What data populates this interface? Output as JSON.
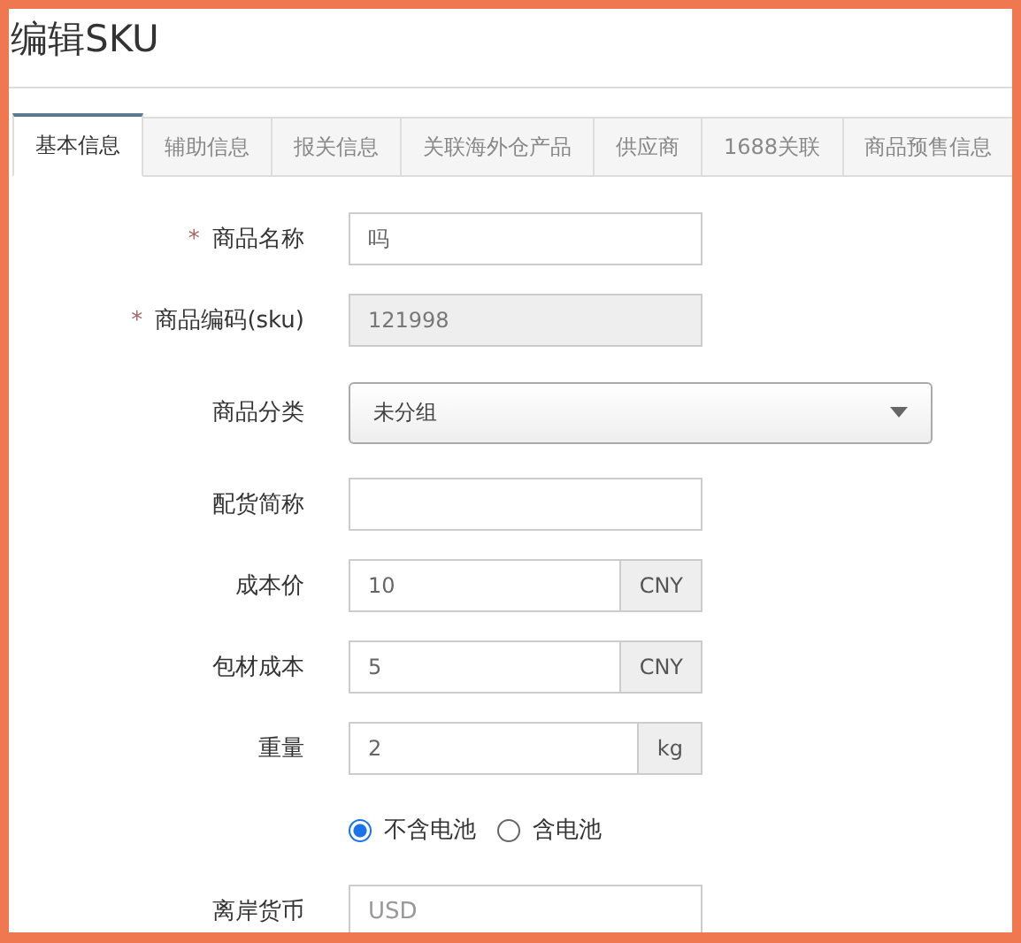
{
  "title": "编辑SKU",
  "tabs": [
    {
      "label": "基本信息",
      "selected": true
    },
    {
      "label": "辅助信息",
      "selected": false
    },
    {
      "label": "报关信息",
      "selected": false
    },
    {
      "label": "关联海外仓产品",
      "selected": false
    },
    {
      "label": "供应商",
      "selected": false
    },
    {
      "label": "1688关联",
      "selected": false
    },
    {
      "label": "商品预售信息",
      "selected": false
    }
  ],
  "fields": [
    {
      "kind": "text",
      "required_mark": "*",
      "label": "商品名称",
      "value": "吗"
    },
    {
      "kind": "text",
      "required_mark": "*",
      "label": "商品编码(sku)",
      "value": "121998",
      "disabled": true
    },
    {
      "kind": "select",
      "label": "商品分类",
      "value": "未分组"
    },
    {
      "kind": "text",
      "label": "配货简称"
    },
    {
      "kind": "addon",
      "label": "成本价",
      "value": "10",
      "addon": "CNY"
    },
    {
      "kind": "addon",
      "label": "包材成本",
      "value": "5",
      "addon": "CNY"
    },
    {
      "kind": "addon",
      "label": "重量",
      "value": "2",
      "addon": "kg"
    },
    {
      "kind": "radio",
      "options": [
        {
          "label": "不含电池",
          "selected": true
        },
        {
          "label": "含电池",
          "selected": false
        }
      ]
    },
    {
      "kind": "text",
      "label": "离岸货币",
      "placeholder": "USD"
    }
  ]
}
